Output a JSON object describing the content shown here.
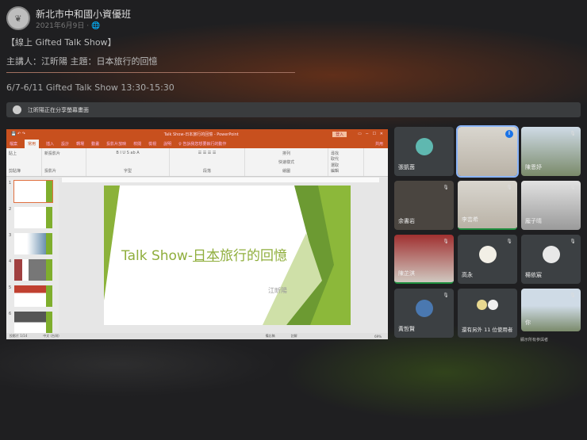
{
  "post": {
    "page_name": "新北市中和國小資優班",
    "date": "2021年6月9日 · 🌐",
    "line1": "【線上 Gifted Talk Show】",
    "line2": "主講人：江昕陽 主題：日本旅行的回憶",
    "line3": "6/7-6/11 Gifted Talk Show 13:30-15:30"
  },
  "meet": {
    "share_notice": "江昕陽正在分享螢幕畫面",
    "ppt": {
      "window_title": "Talk Show-日本旅行的回憶 - PowerPoint",
      "login": "登入",
      "share": "共用",
      "tabs": [
        "檔案",
        "常用",
        "插入",
        "設計",
        "轉場",
        "動畫",
        "投影片放映",
        "校閱",
        "檢視",
        "說明",
        "♀ 告訴我您想要執行的動作"
      ],
      "groups": [
        "剪貼簿",
        "投影片",
        "字型",
        "段落",
        "繪圖",
        "編輯"
      ],
      "buttons": {
        "paste": "貼上",
        "new_slide": "新投影片",
        "arrange": "排列",
        "quick_styles": "快速樣式",
        "find": "尋找",
        "replace": "取代",
        "select": "選取"
      },
      "slide_numbers": [
        "1",
        "2",
        "3",
        "4",
        "5",
        "6"
      ],
      "slide_title_a": "Talk Show-",
      "slide_title_b": "日本",
      "slide_title_c": "旅行的回憶",
      "slide_author": "江昕陽",
      "status_slide": "投影片 1/14",
      "status_lang": "中文 (台灣)",
      "status_notes": "備忘稿",
      "status_comments": "註解",
      "zoom": "69%"
    },
    "participants": [
      {
        "name": "張凱茵",
        "type": "avatar",
        "color": "#5fb8b0"
      },
      {
        "name": "",
        "type": "video",
        "speaking": true
      },
      {
        "name": "陳恩妤",
        "type": "video"
      },
      {
        "name": "余書岩",
        "type": "video"
      },
      {
        "name": "李芸希",
        "type": "video"
      },
      {
        "name": "龐子晴",
        "type": "video"
      },
      {
        "name": "陳芷淇",
        "type": "video"
      },
      {
        "name": "高永",
        "type": "avatar",
        "color": "#f2efe6"
      },
      {
        "name": "楊依宸",
        "type": "avatar",
        "color": "#e8e8e8"
      },
      {
        "name": "黃哲賢",
        "type": "avatar",
        "color": "#4a78b0"
      },
      {
        "name": "還有另外 11 位使用者",
        "type": "more"
      },
      {
        "name": "你",
        "type": "video"
      }
    ],
    "self_caption": "顯示所有參與者"
  }
}
